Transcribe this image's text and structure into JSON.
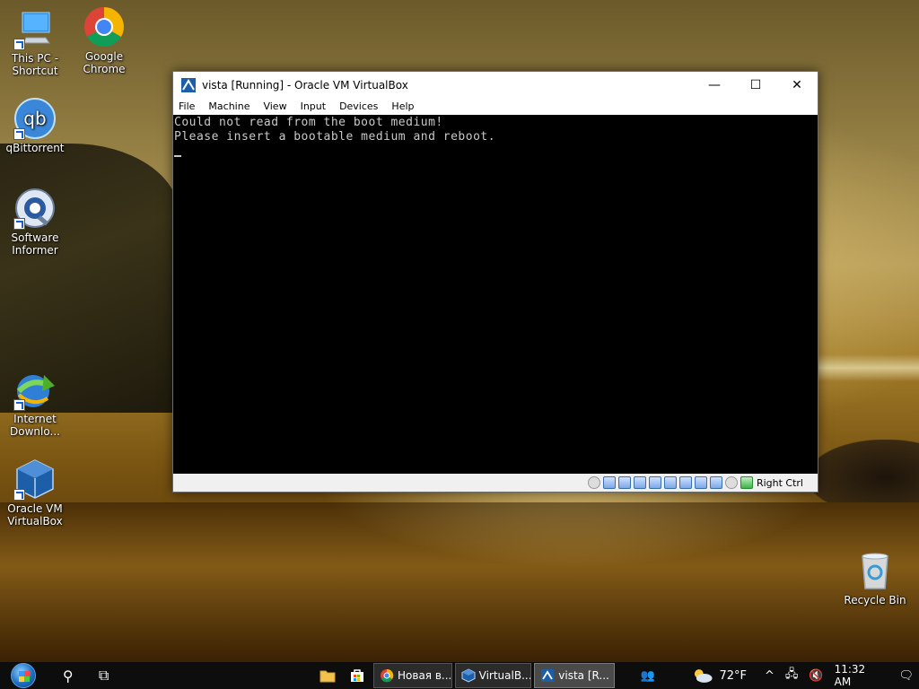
{
  "desktop": {
    "icons": [
      {
        "label": "This PC - Shortcut",
        "icon": "computer-icon"
      },
      {
        "label": "Google Chrome",
        "icon": "chrome-icon"
      },
      {
        "label": "qBittorrent",
        "icon": "qbittorrent-icon"
      },
      {
        "label": "Software Informer",
        "icon": "software-informer-icon"
      },
      {
        "label": "Internet Downlo...",
        "icon": "internet-download-manager-icon"
      },
      {
        "label": "Oracle VM VirtualBox",
        "icon": "virtualbox-icon"
      },
      {
        "label": "Recycle Bin",
        "icon": "recycle-bin-icon"
      }
    ],
    "qb_glyph": "qb"
  },
  "window": {
    "title": "vista [Running] - Oracle VM VirtualBox",
    "minimize": "—",
    "maximize": "☐",
    "close": "✕",
    "menu": [
      "File",
      "Machine",
      "View",
      "Input",
      "Devices",
      "Help"
    ],
    "console_lines": [
      "Could not read from the boot medium!",
      "Please insert a bootable medium and reboot."
    ],
    "host_key": "Right Ctrl"
  },
  "taskbar": {
    "search_glyph": "⚲",
    "taskview_glyph": "⧉",
    "apps": [
      {
        "label": "Новая в...",
        "icon": "chrome-icon"
      },
      {
        "label": "VirtualB...",
        "icon": "virtualbox-icon"
      },
      {
        "label": "vista [R...",
        "icon": "vm-window-icon"
      }
    ],
    "weather": "72°F",
    "time": "11:32 AM",
    "tray_glyphs": {
      "people": "👥",
      "chevron": "^",
      "network": "🖧",
      "volume": "🔇",
      "notifications": "🗨"
    }
  },
  "colors": {
    "console_bg": "#000000",
    "console_text": "#c8c8c8",
    "taskbar_bg": "#0d0d0d"
  }
}
